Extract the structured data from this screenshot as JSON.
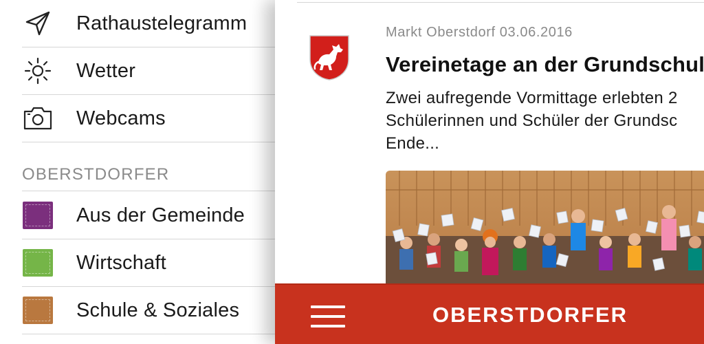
{
  "menu": {
    "top_items": [
      {
        "label": "Rathaustelegramm",
        "icon": "paper-plane-icon"
      },
      {
        "label": "Wetter",
        "icon": "sun-icon"
      },
      {
        "label": "Webcams",
        "icon": "camera-icon"
      }
    ],
    "section_title": "OBERSTDORFER",
    "category_items": [
      {
        "label": "Aus der Gemeinde",
        "color": "#7b2f7d"
      },
      {
        "label": "Wirtschaft",
        "color": "#75b548"
      },
      {
        "label": "Schule & Soziales",
        "color": "#b9783f"
      }
    ]
  },
  "article": {
    "meta": "Markt Oberstdorf 03.06.2016",
    "title": "Vereinetage an der Grundschul",
    "teaser_lines": [
      "Zwei aufregende Vormittage erlebten 2",
      "Schülerinnen und Schüler der Grundsc",
      "Ende..."
    ],
    "crest_icon": "municipal-crest-horse-icon"
  },
  "bottom_bar": {
    "brand": "OBERSTDORFER",
    "menu_icon": "hamburger-menu-icon",
    "color": "#c8321e"
  }
}
